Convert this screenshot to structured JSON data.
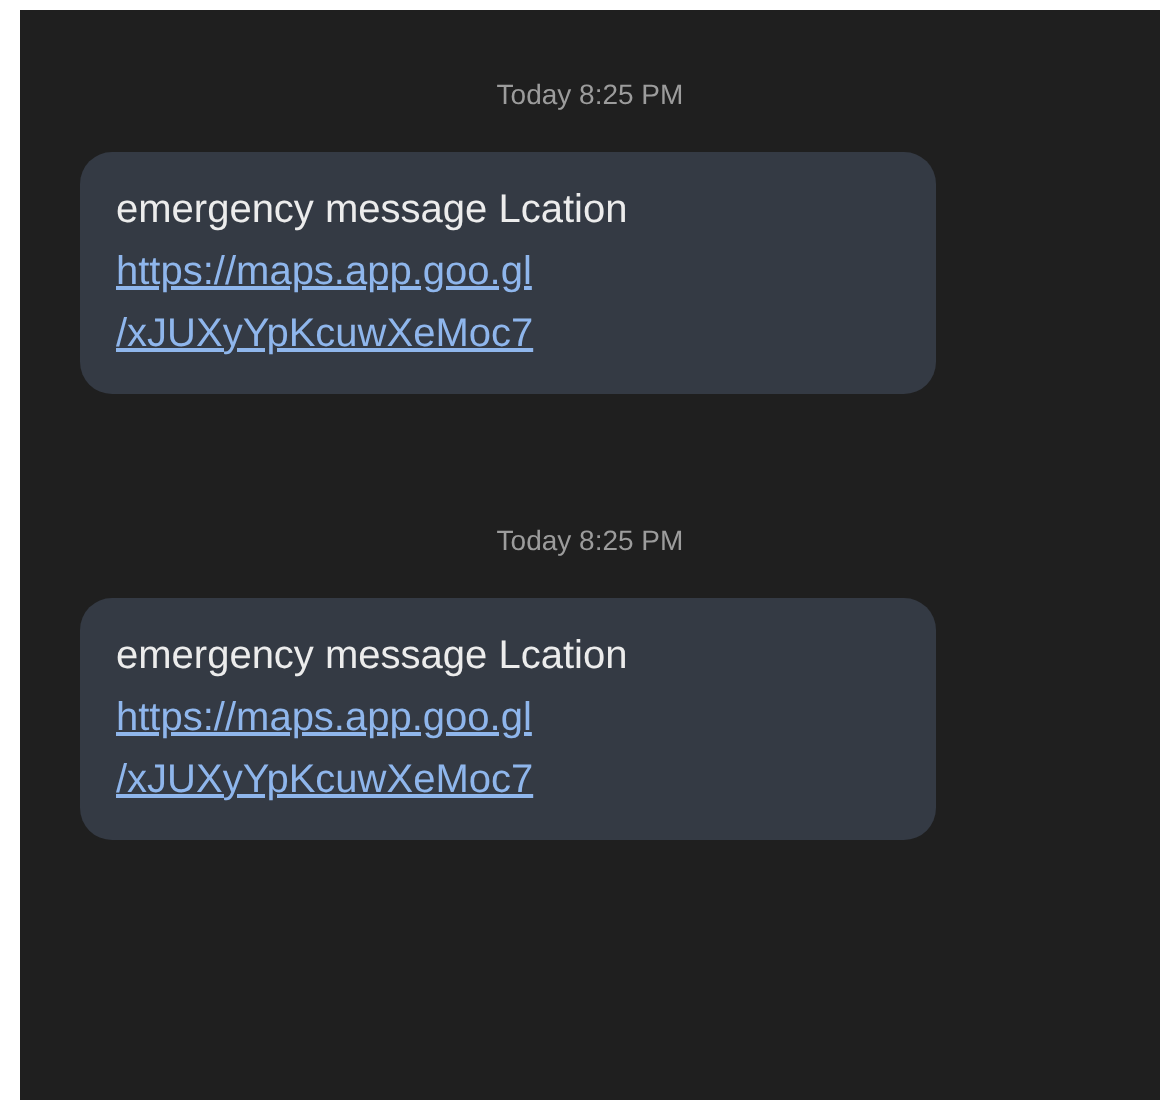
{
  "messages": [
    {
      "timestamp": "Today 8:25 PM",
      "text": "emergency message Lcation",
      "link_lines": [
        "https://maps.app.goo.gl",
        "/xJUXyYpKcuwXeMoc7"
      ]
    },
    {
      "timestamp": "Today 8:25 PM",
      "text": "emergency message Lcation",
      "link_lines": [
        "https://maps.app.goo.gl",
        "/xJUXyYpKcuwXeMoc7"
      ]
    }
  ]
}
